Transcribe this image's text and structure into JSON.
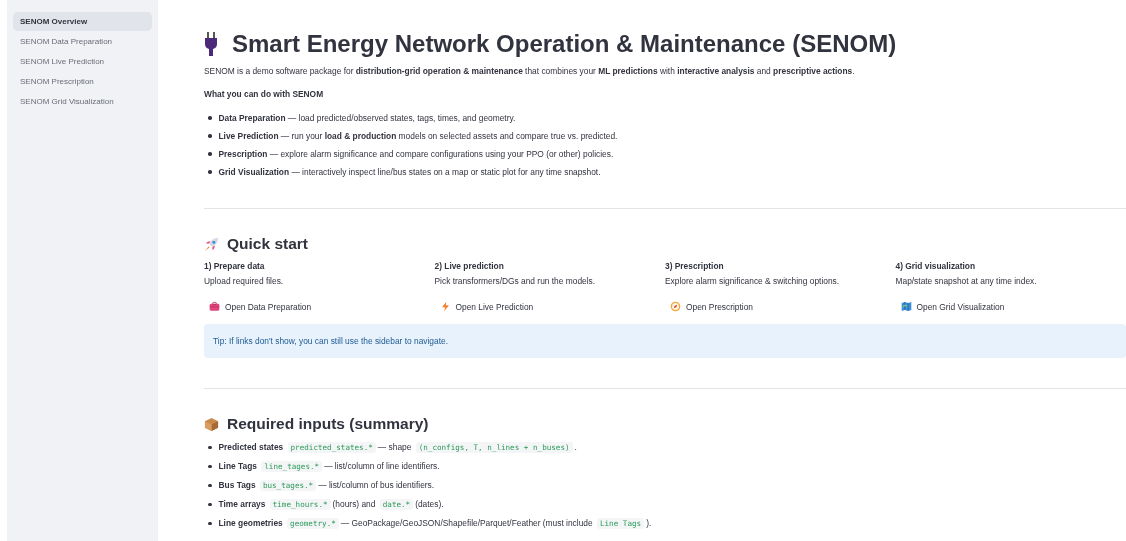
{
  "sidebar": {
    "items": [
      {
        "label": "SENOM Overview",
        "selected": true
      },
      {
        "label": "SENOM Data Preparation",
        "selected": false
      },
      {
        "label": "SENOM Live Prediction",
        "selected": false
      },
      {
        "label": "SENOM Prescription",
        "selected": false
      },
      {
        "label": "SENOM Grid Visualization",
        "selected": false
      }
    ]
  },
  "title": "Smart Energy Network Operation & Maintenance (SENOM)",
  "intro": "SENOM is a demo software package for **distribution-grid operation & maintenance** that combines your **ML predictions** with **interactive analysis** and **prescriptive actions**.",
  "features_heading": "What you can do with SENOM",
  "features": [
    "**Data Preparation** — load predicted/observed states, tags, times, and geometry.",
    "**Live Prediction** — run your **load & production** models on selected assets and compare true vs. predicted.",
    "**Prescription** — explore alarm significance and compare configurations using your PPO (or other) policies.",
    "**Grid Visualization** — interactively inspect line/bus states on a map or static plot for any time snapshot."
  ],
  "quick_start": {
    "heading": "Quick start",
    "steps": [
      {
        "title": "1) Prepare data",
        "text": "Upload required files.",
        "link": "Open Data Preparation"
      },
      {
        "title": "2) Live prediction",
        "text": "Pick transformers/DGs and run the models.",
        "link": "Open Live Prediction"
      },
      {
        "title": "3) Prescription",
        "text": "Explore alarm significance & switching options.",
        "link": "Open Prescription"
      },
      {
        "title": "4) Grid visualization",
        "text": "Map/state snapshot at any time index.",
        "link": "Open Grid Visualization"
      }
    ],
    "tip": "Tip: If links don't show, you can still use the sidebar to navigate."
  },
  "inputs": {
    "heading": "Required inputs (summary)",
    "items": [
      {
        "term": "Predicted states",
        "parts": [
          {
            "kind": "code",
            "text": "predicted_states.*"
          },
          {
            "kind": "text",
            "text": "— shape"
          },
          {
            "kind": "code",
            "text": "(n_configs, T, n_lines + n_buses)"
          },
          {
            "kind": "text",
            "text": "."
          }
        ]
      },
      {
        "term": "Line Tags",
        "parts": [
          {
            "kind": "code",
            "text": "line_tages.*"
          },
          {
            "kind": "text",
            "text": "— list/column of line identifiers."
          }
        ]
      },
      {
        "term": "Bus Tags",
        "parts": [
          {
            "kind": "code",
            "text": "bus_tages.*"
          },
          {
            "kind": "text",
            "text": "— list/column of bus identifiers."
          }
        ]
      },
      {
        "term": "Time arrays",
        "parts": [
          {
            "kind": "code",
            "text": "time_hours.*"
          },
          {
            "kind": "text",
            "text": "(hours) and"
          },
          {
            "kind": "code",
            "text": "date.*"
          },
          {
            "kind": "text",
            "text": "(dates)."
          }
        ]
      },
      {
        "term": "Line geometries",
        "parts": [
          {
            "kind": "code",
            "text": "geometry.*"
          },
          {
            "kind": "text",
            "text": "— GeoPackage/GeoJSON/Shapefile/Parquet/Feather (must include"
          },
          {
            "kind": "code",
            "text": "Line Tags"
          },
          {
            "kind": "text",
            "text": ")."
          }
        ]
      }
    ]
  }
}
